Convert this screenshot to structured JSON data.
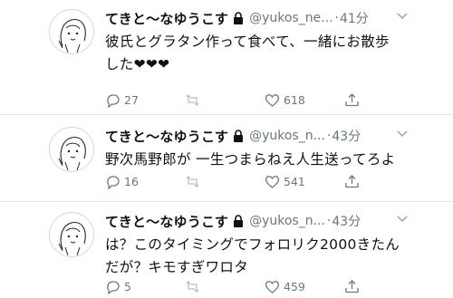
{
  "tweets": [
    {
      "name": "てきと〜なゆうこす",
      "handle": "@yukos_ne...",
      "sep": "·",
      "time": "41分",
      "lines": [
        "彼氏とグラタン作って食べて、一緒にお散歩",
        "した❤❤❤"
      ],
      "replies": "27",
      "retweets": "",
      "likes": "618"
    },
    {
      "name": "てきと〜なゆうこす",
      "handle": "@yukos_n...",
      "sep": "·",
      "time": "43分",
      "lines": [
        "野次馬野郎が 一生つまらねえ人生送ってろよ"
      ],
      "replies": "16",
      "retweets": "",
      "likes": "541"
    },
    {
      "name": "てきと〜なゆうこす",
      "handle": "@yukos_n...",
      "sep": "·",
      "time": "43分",
      "lines": [
        "は？このタイミングでフォロリク2000きたん",
        "だが？キモすぎワロタ"
      ],
      "replies": "5",
      "retweets": "",
      "likes": "459"
    }
  ],
  "icons": {
    "lock": "lock-icon",
    "menu": "chevron-down-icon",
    "reply": "reply-icon",
    "retweet": "retweet-icon",
    "like": "heart-icon",
    "share": "share-icon"
  },
  "colors": {
    "text": "#111111",
    "muted": "#6b7680",
    "divider": "#e3e6e8"
  }
}
